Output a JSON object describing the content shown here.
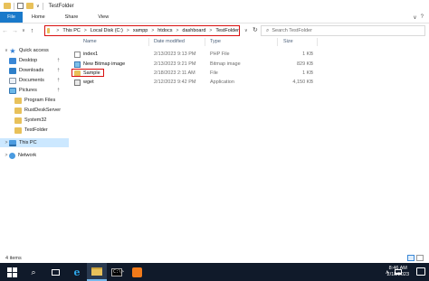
{
  "window": {
    "title": "TestFolder",
    "qat_dropdown": "∨"
  },
  "ribbon": {
    "file_tab": "File",
    "tabs": [
      "Home",
      "Share",
      "View"
    ],
    "expand_glyph": "∨",
    "help_glyph": "?"
  },
  "nav": {
    "back_glyph": "←",
    "forward_glyph": "→",
    "recent_glyph": "∨",
    "up_glyph": "↑",
    "crumb_sep": ">",
    "breadcrumbs": [
      "This PC",
      "Local Disk (C:)",
      "xampp",
      "htdocs",
      "dashboard",
      "TestFolder"
    ],
    "address_dropdown": "∨",
    "refresh_glyph": "↻",
    "search_placeholder": "Search TestFolder"
  },
  "sidebar": {
    "chevron_glyph": ">",
    "pin_glyph": "†",
    "quick_access": "Quick access",
    "pinned": [
      {
        "label": "Desktop",
        "icon": "desktop-icon"
      },
      {
        "label": "Downloads",
        "icon": "downloads-icon"
      },
      {
        "label": "Documents",
        "icon": "documents-icon"
      },
      {
        "label": "Pictures",
        "icon": "pictures-icon"
      }
    ],
    "folders": [
      "Program Files",
      "RustDeskServer",
      "System32",
      "TestFolder"
    ],
    "this_pc": "This PC",
    "network": "Network"
  },
  "columns": {
    "name": "Name",
    "date_modified": "Date modified",
    "type": "Type",
    "size": "Size"
  },
  "files": [
    {
      "name": "index1",
      "date": "2/13/2023 9:13 PM",
      "type": "PHP File",
      "size": "1 KB",
      "icon": "php-file-icon"
    },
    {
      "name": "New Bitmap image",
      "date": "2/13/2023 9:21 PM",
      "type": "Bitmap image",
      "size": "829 KB",
      "icon": "bitmap-file-icon"
    },
    {
      "name": "Sample",
      "date": "2/18/2023 2:11 AM",
      "type": "File",
      "size": "1 KB",
      "icon": "sample-file-icon"
    },
    {
      "name": "wget",
      "date": "2/12/2023 9:42 PM",
      "type": "Application",
      "size": "4,150 KB",
      "icon": "wget-app-icon"
    }
  ],
  "status": {
    "item_count": "4 items"
  },
  "taskbar": {
    "time": "8:46 AM",
    "date": "2/18/2023",
    "tray_chevron": "∧",
    "search_glyph": "⌕",
    "cmd_prompt": "C:\\>",
    "ie_glyph": "e"
  },
  "colors": {
    "accent": "#1979ca",
    "highlight_border": "#d80f0f",
    "selection": "#cce8ff",
    "taskbar": "#101a2a"
  }
}
